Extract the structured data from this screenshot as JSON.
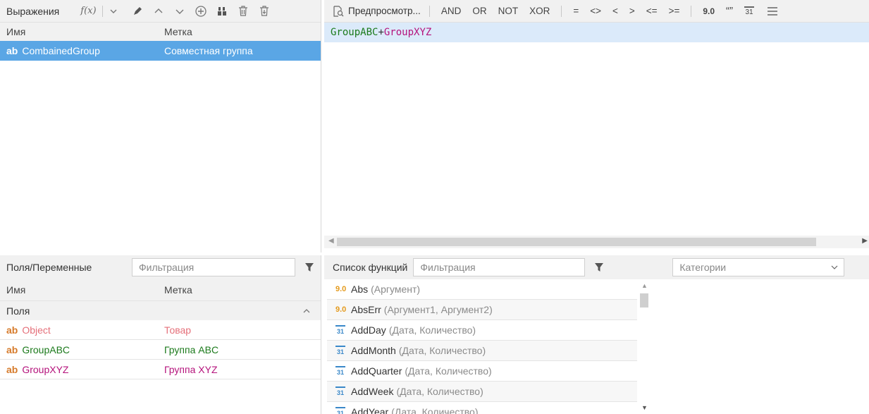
{
  "expressions": {
    "title": "Выражения",
    "fx_label": "f(x)",
    "col_name": "Имя",
    "col_label": "Метка",
    "rows": [
      {
        "type": "ab",
        "name": "CombainedGroup",
        "label": "Совместная группа"
      }
    ]
  },
  "editor": {
    "preview_label": "Предпросмотр...",
    "ops": [
      "AND",
      "OR",
      "NOT",
      "XOR"
    ],
    "cmp_ops": [
      "=",
      "<>",
      "<",
      ">",
      "<=",
      ">="
    ],
    "num_label": "9.0",
    "quote_label": "“”",
    "date_label": "31",
    "expression_tokens": [
      {
        "text": "GroupABC",
        "kind": "g"
      },
      {
        "text": "+",
        "kind": "op"
      },
      {
        "text": "GroupXYZ",
        "kind": "p"
      }
    ]
  },
  "fields": {
    "title": "Поля/Переменные",
    "filter_placeholder": "Фильтрация",
    "col_name": "Имя",
    "col_label": "Метка",
    "group_label": "Поля",
    "rows": [
      {
        "type": "ab",
        "name": "Object",
        "label": "Товар",
        "color": "#e5707a"
      },
      {
        "type": "ab",
        "name": "GroupABC",
        "label": "Группа ABC",
        "color": "#1b7a1b"
      },
      {
        "type": "ab",
        "name": "GroupXYZ",
        "label": "Группа XYZ",
        "color": "#b5137c"
      }
    ]
  },
  "functions": {
    "title": "Список функций",
    "filter_placeholder": "Фильтрация",
    "category_placeholder": "Категории",
    "items": [
      {
        "icon": "num",
        "name": "Abs",
        "args": "(Аргумент)"
      },
      {
        "icon": "num",
        "name": "AbsErr",
        "args": "(Аргумент1, Аргумент2)"
      },
      {
        "icon": "date",
        "name": "AddDay",
        "args": "(Дата, Количество)"
      },
      {
        "icon": "date",
        "name": "AddMonth",
        "args": "(Дата, Количество)"
      },
      {
        "icon": "date",
        "name": "AddQuarter",
        "args": "(Дата, Количество)"
      },
      {
        "icon": "date",
        "name": "AddWeek",
        "args": "(Дата, Количество)"
      },
      {
        "icon": "date",
        "name": "AddYear",
        "args": "(Дата, Количество)"
      }
    ]
  },
  "colors": {
    "selection": "#5aa6e5",
    "editor_line": "#dbeafa",
    "green_token": "#1b7a1b",
    "purple_token": "#b5137c"
  }
}
